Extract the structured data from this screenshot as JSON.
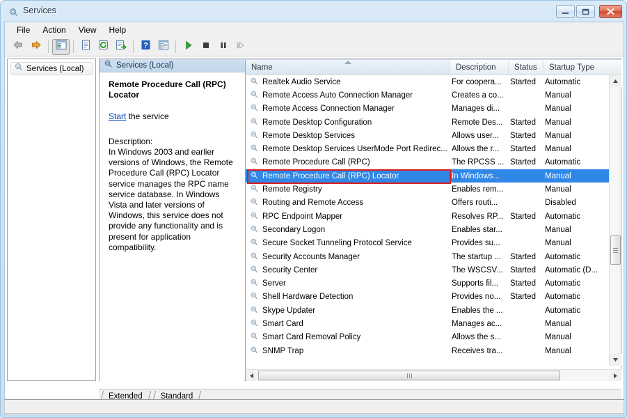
{
  "window": {
    "title": "Services",
    "icon": "services-gear-icon",
    "buttons": {
      "minimize": "Minimize",
      "maximize": "Maximize",
      "close": "Close"
    }
  },
  "menubar": {
    "items": [
      {
        "label": "File",
        "name": "menu-file"
      },
      {
        "label": "Action",
        "name": "menu-action"
      },
      {
        "label": "View",
        "name": "menu-view"
      },
      {
        "label": "Help",
        "name": "menu-help"
      }
    ]
  },
  "toolbar": {
    "buttons": [
      {
        "name": "back-icon",
        "tip": "Back"
      },
      {
        "name": "forward-icon",
        "tip": "Forward"
      },
      {
        "name": "show-hide-console-tree-icon",
        "tip": "Show/Hide Console Tree",
        "pressed": true
      },
      {
        "name": "properties-icon",
        "tip": "Properties"
      },
      {
        "name": "refresh-icon",
        "tip": "Refresh"
      },
      {
        "name": "export-list-icon",
        "tip": "Export List"
      },
      {
        "name": "help-icon",
        "tip": "Help"
      },
      {
        "name": "view-icon",
        "tip": "View"
      },
      {
        "name": "start-service-icon",
        "tip": "Start Service"
      },
      {
        "name": "stop-service-icon",
        "tip": "Stop Service"
      },
      {
        "name": "pause-service-icon",
        "tip": "Pause Service"
      },
      {
        "name": "restart-service-icon",
        "tip": "Restart Service"
      }
    ]
  },
  "tree": {
    "root_label": "Services (Local)"
  },
  "pane": {
    "header_label": "Services (Local)"
  },
  "details": {
    "service_title": "Remote Procedure Call (RPC) Locator",
    "action_link": "Start",
    "action_suffix": " the service",
    "description_label": "Description:",
    "description_text": "In Windows 2003 and earlier versions of Windows, the Remote Procedure Call (RPC) Locator service manages the RPC name service database. In Windows Vista and later versions of Windows, this service does not provide any functionality and is present for application compatibility."
  },
  "list": {
    "columns": [
      {
        "label": "Name",
        "name": "column-header-name",
        "sorted": true
      },
      {
        "label": "Description",
        "name": "column-header-description",
        "sorted": false
      },
      {
        "label": "Status",
        "name": "column-header-status",
        "sorted": false
      },
      {
        "label": "Startup Type",
        "name": "column-header-startup-type",
        "sorted": false
      }
    ],
    "rows": [
      {
        "name": "Realtek Audio Service",
        "description": "For coopera...",
        "status": "Started",
        "startup": "Automatic",
        "selected": false
      },
      {
        "name": "Remote Access Auto Connection Manager",
        "description": "Creates a co...",
        "status": "",
        "startup": "Manual",
        "selected": false
      },
      {
        "name": "Remote Access Connection Manager",
        "description": "Manages di...",
        "status": "",
        "startup": "Manual",
        "selected": false
      },
      {
        "name": "Remote Desktop Configuration",
        "description": "Remote Des...",
        "status": "Started",
        "startup": "Manual",
        "selected": false
      },
      {
        "name": "Remote Desktop Services",
        "description": "Allows user...",
        "status": "Started",
        "startup": "Manual",
        "selected": false
      },
      {
        "name": "Remote Desktop Services UserMode Port Redirec...",
        "description": "Allows the r...",
        "status": "Started",
        "startup": "Manual",
        "selected": false
      },
      {
        "name": "Remote Procedure Call (RPC)",
        "description": "The RPCSS ...",
        "status": "Started",
        "startup": "Automatic",
        "selected": false
      },
      {
        "name": "Remote Procedure Call (RPC) Locator",
        "description": "In Windows...",
        "status": "",
        "startup": "Manual",
        "selected": true
      },
      {
        "name": "Remote Registry",
        "description": "Enables rem...",
        "status": "",
        "startup": "Manual",
        "selected": false
      },
      {
        "name": "Routing and Remote Access",
        "description": "Offers routi...",
        "status": "",
        "startup": "Disabled",
        "selected": false
      },
      {
        "name": "RPC Endpoint Mapper",
        "description": "Resolves RP...",
        "status": "Started",
        "startup": "Automatic",
        "selected": false
      },
      {
        "name": "Secondary Logon",
        "description": "Enables star...",
        "status": "",
        "startup": "Manual",
        "selected": false
      },
      {
        "name": "Secure Socket Tunneling Protocol Service",
        "description": "Provides su...",
        "status": "",
        "startup": "Manual",
        "selected": false
      },
      {
        "name": "Security Accounts Manager",
        "description": "The startup ...",
        "status": "Started",
        "startup": "Automatic",
        "selected": false
      },
      {
        "name": "Security Center",
        "description": "The WSCSV...",
        "status": "Started",
        "startup": "Automatic (D...",
        "selected": false
      },
      {
        "name": "Server",
        "description": "Supports fil...",
        "status": "Started",
        "startup": "Automatic",
        "selected": false
      },
      {
        "name": "Shell Hardware Detection",
        "description": "Provides no...",
        "status": "Started",
        "startup": "Automatic",
        "selected": false
      },
      {
        "name": "Skype Updater",
        "description": "Enables the ...",
        "status": "",
        "startup": "Automatic",
        "selected": false
      },
      {
        "name": "Smart Card",
        "description": "Manages ac...",
        "status": "",
        "startup": "Manual",
        "selected": false
      },
      {
        "name": "Smart Card Removal Policy",
        "description": "Allows the s...",
        "status": "",
        "startup": "Manual",
        "selected": false
      },
      {
        "name": "SNMP Trap",
        "description": "Receives tra...",
        "status": "",
        "startup": "Manual",
        "selected": false
      }
    ],
    "row_icon": "service-gear-icon"
  },
  "tabs": [
    {
      "label": "Extended",
      "name": "tab-extended",
      "active": false
    },
    {
      "label": "Standard",
      "name": "tab-standard",
      "active": true
    }
  ],
  "colors": {
    "selection": "#2f87e8",
    "annotation": "#e01b1b",
    "link": "#0645c4",
    "title_bar": "#d9e9f7"
  }
}
